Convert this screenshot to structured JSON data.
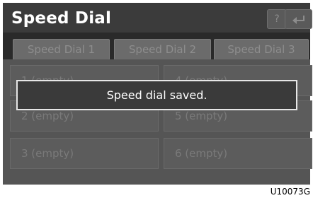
{
  "header": {
    "title": "Speed Dial",
    "help_icon": "?",
    "back_icon": "back-arrow"
  },
  "tabs": [
    {
      "label": "Speed Dial 1"
    },
    {
      "label": "Speed Dial 2"
    },
    {
      "label": "Speed Dial 3"
    }
  ],
  "entries": [
    {
      "label": "1 (empty)"
    },
    {
      "label": "2 (empty)"
    },
    {
      "label": "3 (empty)"
    },
    {
      "label": "4 (empty)"
    },
    {
      "label": "5 (empty)"
    },
    {
      "label": "6 (empty)"
    }
  ],
  "notification": {
    "text": "Speed dial saved."
  },
  "image_code": "U10073G"
}
